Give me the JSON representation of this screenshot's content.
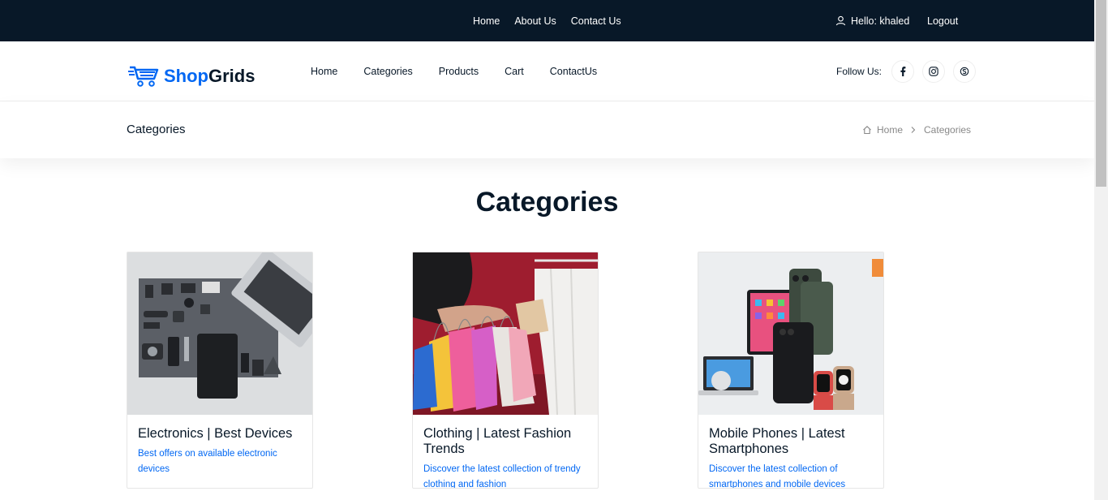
{
  "topbar": {
    "nav": [
      "Home",
      "About Us",
      "Contact Us"
    ],
    "user_greeting": "Hello: khaled",
    "logout": "Logout"
  },
  "header": {
    "logo_shop": "Shop",
    "logo_grids": "Grids",
    "nav": [
      "Home",
      "Categories",
      "Products",
      "Cart",
      "ContactUs"
    ],
    "follow_label": "Follow Us:",
    "social_icons": [
      "facebook-icon",
      "instagram-icon",
      "skype-icon"
    ]
  },
  "breadcrumb": {
    "page_title": "Categories",
    "home": "Home",
    "current": "Categories"
  },
  "section": {
    "title": "Categories"
  },
  "cards": [
    {
      "title": "Electronics | Best Devices",
      "description": "Best offers on available electronic devices",
      "image_icon": "electronics-flatlay-image"
    },
    {
      "title": "Clothing | Latest Fashion Trends",
      "description": "Discover the latest collection of trendy clothing and fashion",
      "image_icon": "shopping-bags-image"
    },
    {
      "title": "Mobile Phones | Latest Smartphones",
      "description": "Discover the latest collection of smartphones and mobile devices",
      "image_icon": "smartphones-devices-image"
    }
  ],
  "colors": {
    "dark": "#081828",
    "accent": "#0167f3"
  }
}
